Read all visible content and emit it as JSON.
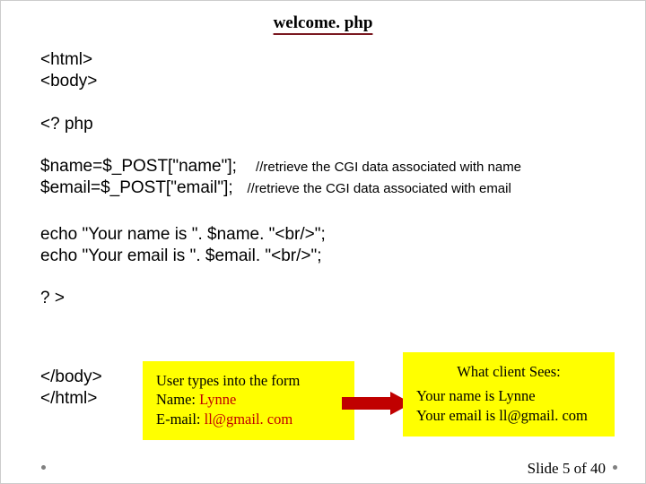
{
  "title": "welcome. php",
  "code": {
    "html_open": "<html>",
    "body_open": "<body>",
    "php_open": "<? php",
    "assign_name": "$name=$_POST[\"name\"];",
    "assign_name_comment": "//retrieve the CGI data associated with name",
    "assign_email": "$email=$_POST[\"email\"];",
    "assign_email_comment": "//retrieve the CGI data associated with email",
    "echo_name": "echo \"Your name is \". $name. \"<br/>\";",
    "echo_email": "echo \"Your email is \". $email. \"<br/>\";",
    "php_close": "? >",
    "body_close": "</body>",
    "html_close": "</html>"
  },
  "left_box": {
    "line1": "User types into the form",
    "name_label": "Name:  ",
    "name_value": "Lynne",
    "email_label": "E-mail:  ",
    "email_value": "ll@gmail. com"
  },
  "right_box": {
    "heading": "What client Sees:",
    "line1": "Your name is Lynne",
    "line2": "Your email is ll@gmail. com"
  },
  "footer": "Slide 5 of 40"
}
